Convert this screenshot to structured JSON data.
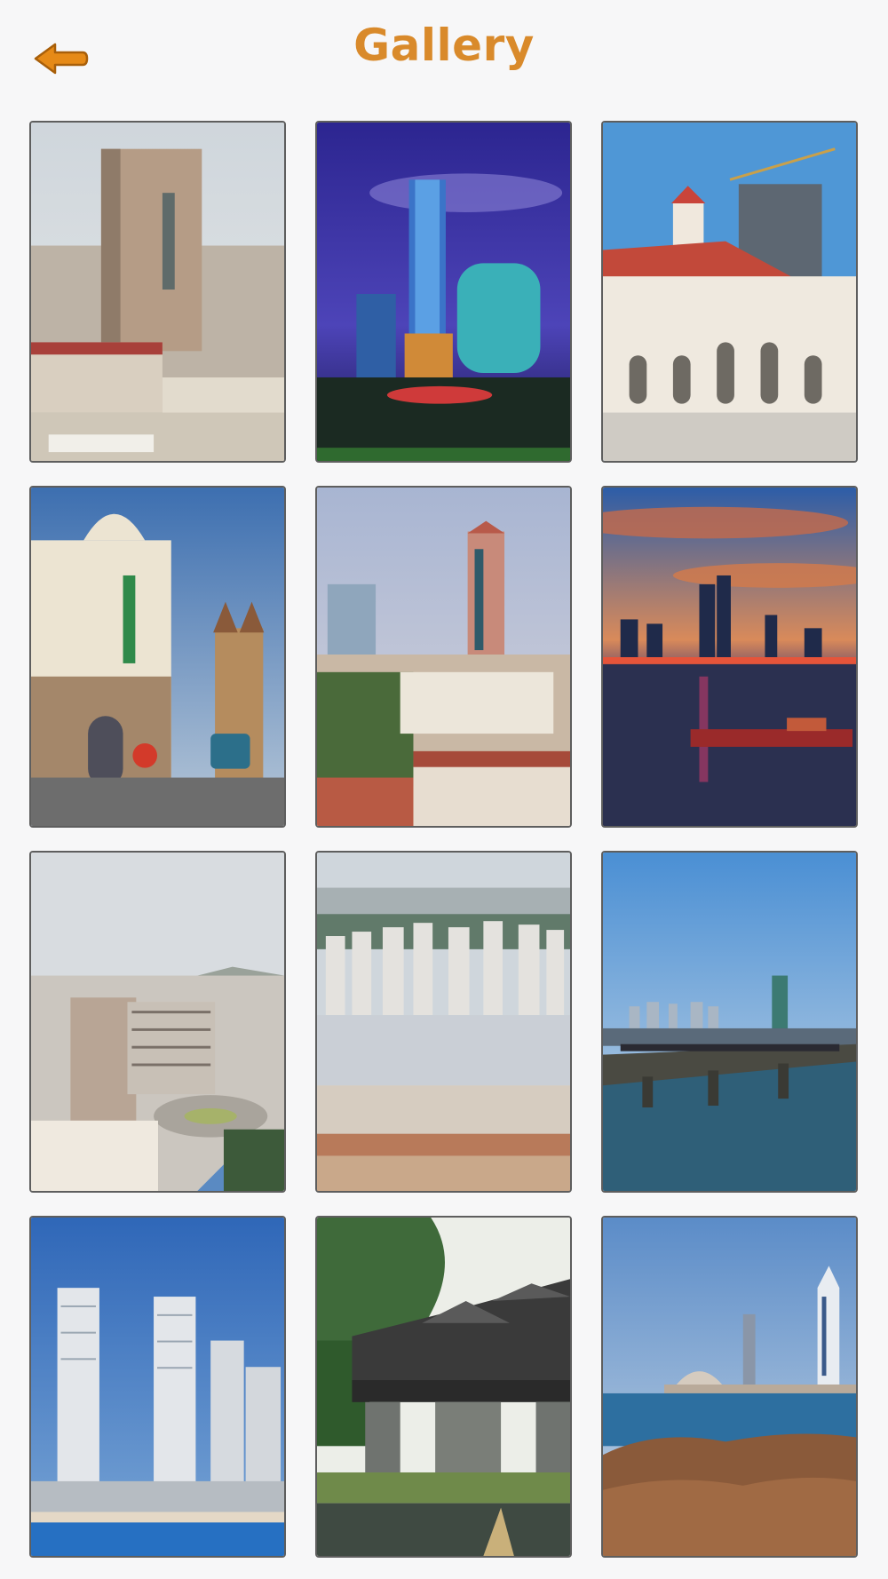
{
  "header": {
    "title": "Gallery",
    "back_icon": "arrow-left-icon",
    "accent_color": "#d98a2b"
  },
  "gallery": {
    "items": [
      {
        "id": "photo-1",
        "subject": "hotel-tower-cityscape"
      },
      {
        "id": "photo-2",
        "subject": "night-skyscrapers"
      },
      {
        "id": "photo-3",
        "subject": "colonial-station-building"
      },
      {
        "id": "photo-4",
        "subject": "old-town-street-church"
      },
      {
        "id": "photo-5",
        "subject": "tv-tower-city-view"
      },
      {
        "id": "photo-6",
        "subject": "sunset-skyline-harbor"
      },
      {
        "id": "photo-7",
        "subject": "office-building-plaza"
      },
      {
        "id": "photo-8",
        "subject": "dense-residential-towers"
      },
      {
        "id": "photo-9",
        "subject": "pier-with-skyline"
      },
      {
        "id": "photo-10",
        "subject": "modern-twin-towers"
      },
      {
        "id": "photo-11",
        "subject": "covered-wooden-bridge"
      },
      {
        "id": "photo-12",
        "subject": "rocky-shore-skyline"
      }
    ]
  }
}
